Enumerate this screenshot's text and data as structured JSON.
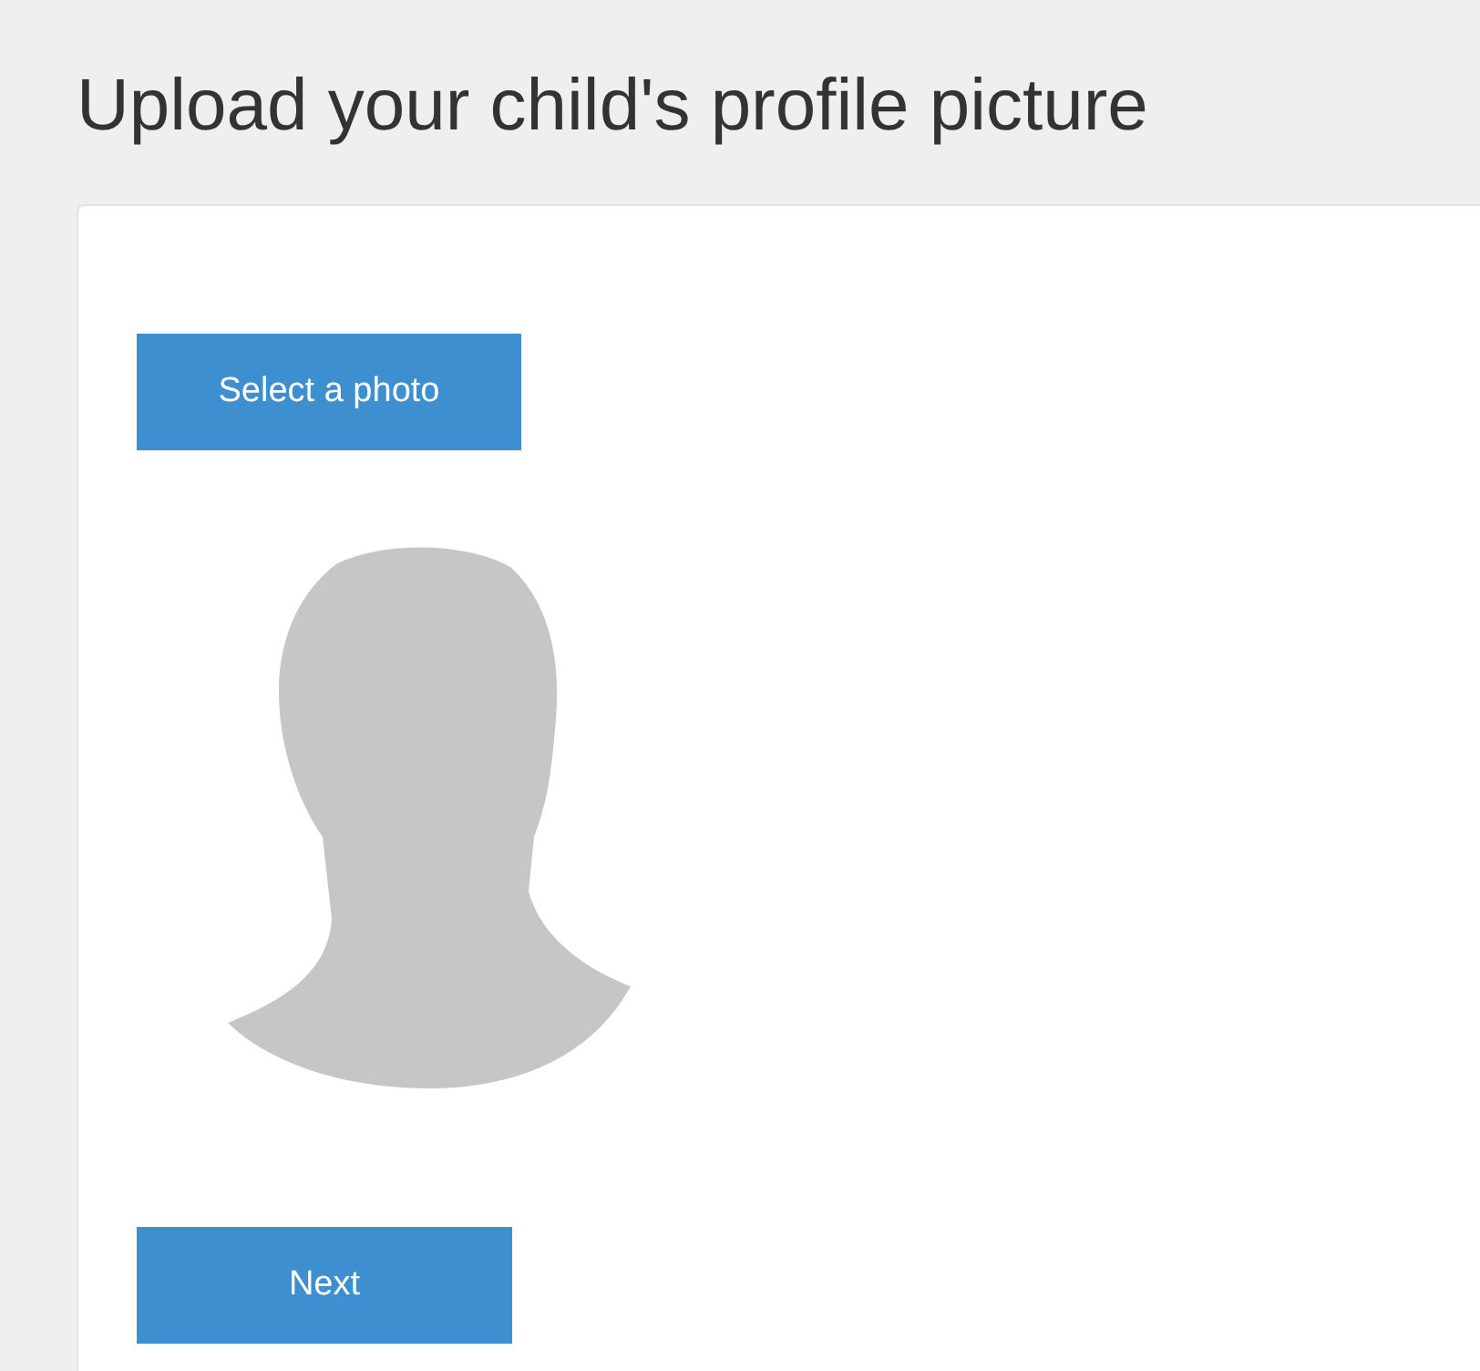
{
  "page": {
    "title": "Upload your child's profile picture"
  },
  "card": {
    "select_button": "Select a photo",
    "avatar": {
      "kind": "silhouette"
    },
    "next_button": "Next"
  }
}
